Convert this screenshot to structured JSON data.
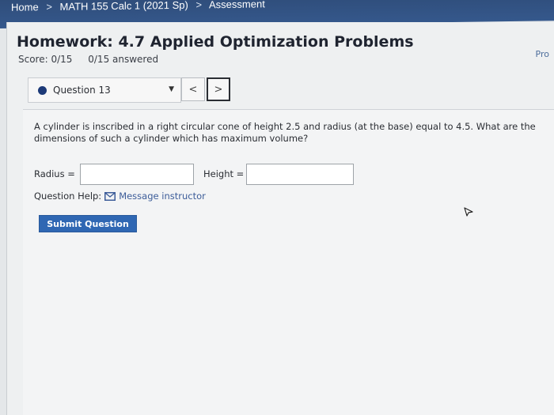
{
  "breadcrumb": {
    "items": [
      "Home",
      "MATH 155 Calc 1 (2021 Sp)",
      "Assessment"
    ],
    "separator": ">"
  },
  "header": {
    "title": "Homework: 4.7 Applied Optimization Problems",
    "score": "Score: 0/15",
    "answered": "0/15 answered",
    "right_link": "Pro"
  },
  "question_nav": {
    "selected": "Question 13",
    "prev_symbol": "<",
    "next_symbol": ">"
  },
  "question": {
    "text": "A cylinder is inscribed in a right circular cone of height 2.5 and radius (at the base) equal to 4.5. What are the dimensions of such a cylinder which has maximum volume?",
    "radius_label": "Radius =",
    "radius_value": "",
    "height_label": "Height =",
    "height_value": ""
  },
  "help": {
    "label": "Question Help:",
    "message": "Message instructor"
  },
  "submit_label": "Submit Question",
  "colors": {
    "topbar": "#35588c",
    "accent": "#2f67b3",
    "link": "#3c5c99"
  }
}
